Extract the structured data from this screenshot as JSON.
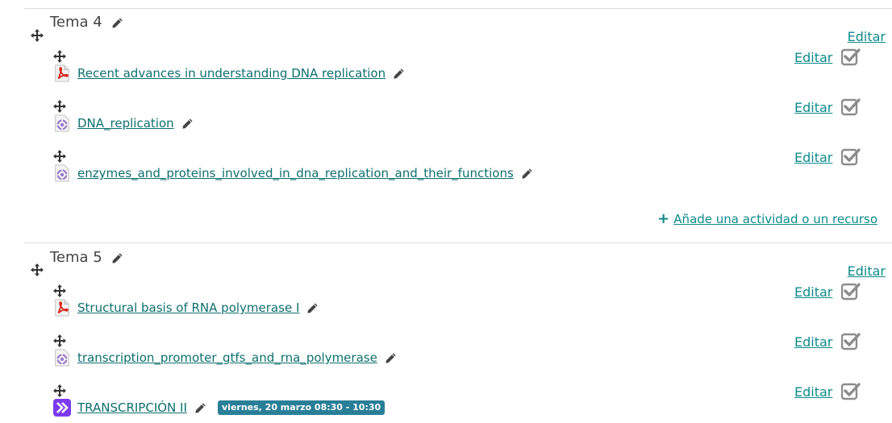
{
  "sections": [
    {
      "title": "Tema 4",
      "edit_label": "Editar",
      "activities": [
        {
          "type": "pdf-icon",
          "name": "Recent advances in understanding DNA replication",
          "edit": "Editar"
        },
        {
          "type": "scorm-icon",
          "name": "DNA_replication",
          "edit": "Editar"
        },
        {
          "type": "scorm-icon",
          "name": "enzymes_and_proteins_involved_in_dna_replication_and_their_functions",
          "edit": "Editar"
        }
      ],
      "add_label": "Añade una actividad o un recurso"
    },
    {
      "title": "Tema 5",
      "edit_label": "Editar",
      "activities": [
        {
          "type": "pdf-icon",
          "name": "Structural basis of RNA polymerase I",
          "edit": "Editar"
        },
        {
          "type": "scorm-icon",
          "name": "transcription_promoter_gtfs_and_rna_polymerase",
          "edit": "Editar"
        },
        {
          "type": "attendance-icon",
          "name": "TRANSCRIPCIÓN II",
          "edit": "Editar",
          "badge": "viernes, 20 marzo 08:30 - 10:30"
        }
      ]
    }
  ],
  "colors": {
    "link": "#0f6f6f",
    "accent": "#0f8a8a",
    "badge": "#2a7f98",
    "check": "#8c8c8c"
  }
}
